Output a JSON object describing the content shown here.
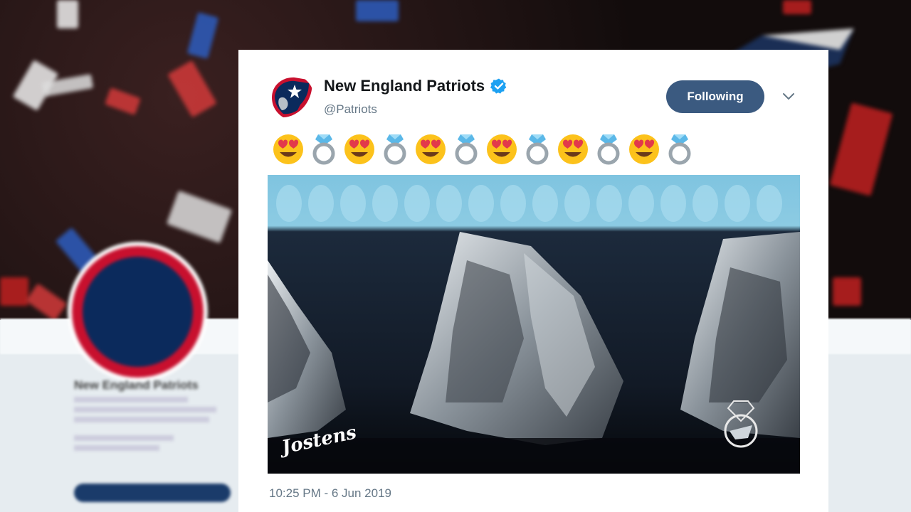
{
  "tweet": {
    "display_name": "New England Patriots",
    "handle": "@Patriots",
    "follow_label": "Following",
    "emojis": [
      "heart-eyes",
      "ring",
      "heart-eyes",
      "ring",
      "heart-eyes",
      "ring",
      "heart-eyes",
      "ring",
      "heart-eyes",
      "ring",
      "heart-eyes",
      "ring"
    ],
    "timestamp": "10:25 PM - 6 Jun 2019",
    "media_watermark_left": "Jostens"
  },
  "background_profile": {
    "display_name": "New England Patriots"
  },
  "colors": {
    "follow_button": "#3b5a80",
    "verified_badge": "#1da1f2",
    "team_navy": "#0b2a5c",
    "team_red": "#c8102e",
    "handle_text": "#657786"
  }
}
